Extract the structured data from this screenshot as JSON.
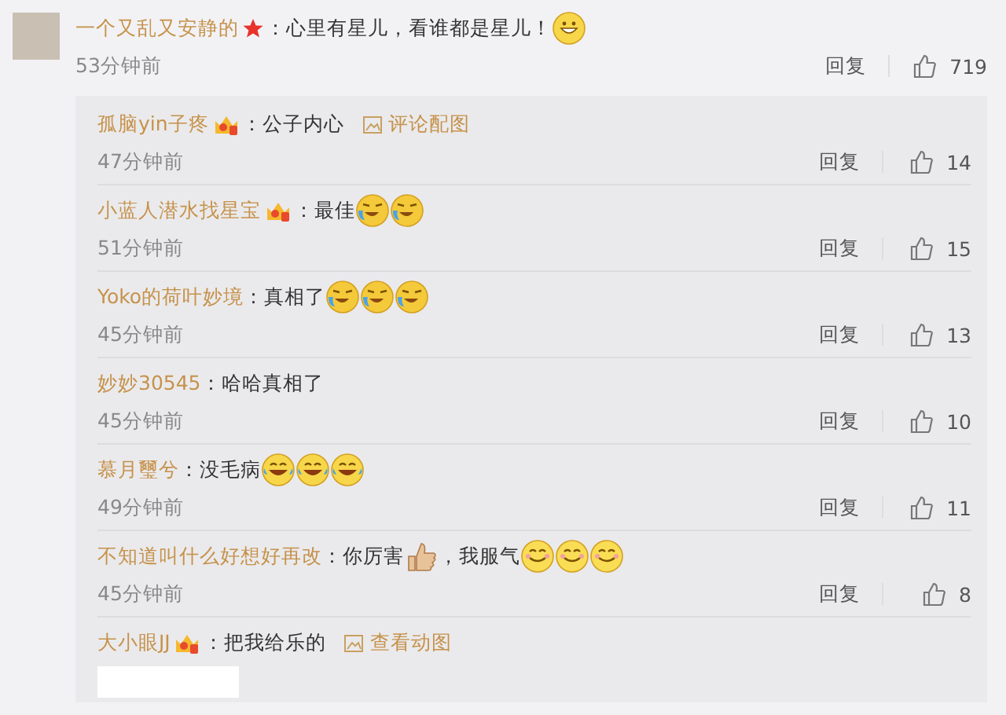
{
  "comment": {
    "author": "一个又乱又安静的",
    "badge": {
      "kind": "star"
    },
    "content": [
      {
        "kind": "text",
        "text": "：心里有星儿，看谁都是星儿！"
      },
      {
        "kind": "grin"
      }
    ],
    "time": "53分钟前",
    "reply_label": "回复",
    "likes": "719"
  },
  "replies": [
    {
      "author": "孤脑yin子疼",
      "badge": {
        "kind": "crown"
      },
      "content": [
        {
          "kind": "text",
          "text": "：公子内心"
        },
        {
          "kind": "link",
          "text": "评论配图"
        }
      ],
      "time": "47分钟前",
      "reply_label": "回复",
      "likes": "14"
    },
    {
      "author": "小蓝人潜水找星宝",
      "badge": {
        "kind": "crown"
      },
      "content": [
        {
          "kind": "text",
          "text": "：最佳"
        },
        {
          "kind": "tears"
        },
        {
          "kind": "tears"
        }
      ],
      "time": "51分钟前",
      "reply_label": "回复",
      "likes": "15"
    },
    {
      "author": "Yoko的荷叶妙境",
      "content": [
        {
          "kind": "text",
          "text": "：真相了"
        },
        {
          "kind": "tears"
        },
        {
          "kind": "tears"
        },
        {
          "kind": "tears"
        }
      ],
      "time": "45分钟前",
      "reply_label": "回复",
      "likes": "13"
    },
    {
      "author": "妙妙30545",
      "content": [
        {
          "kind": "text",
          "text": "：哈哈真相了"
        }
      ],
      "time": "45分钟前",
      "reply_label": "回复",
      "likes": "10"
    },
    {
      "author": "慕月璽兮",
      "content": [
        {
          "kind": "text",
          "text": "：没毛病"
        },
        {
          "kind": "laugh"
        },
        {
          "kind": "laugh"
        },
        {
          "kind": "laugh"
        }
      ],
      "time": "49分钟前",
      "reply_label": "回复",
      "likes": "11"
    },
    {
      "author": "不知道叫什么好想好再改",
      "content": [
        {
          "kind": "text",
          "text": "：你厉害"
        },
        {
          "kind": "thumb"
        },
        {
          "kind": "text",
          "text": "，我服气"
        },
        {
          "kind": "smile"
        },
        {
          "kind": "smile"
        },
        {
          "kind": "smile"
        }
      ],
      "time": "45分钟前",
      "reply_label": "回复",
      "likes": "8"
    },
    {
      "author": "大小眼JJ",
      "badge": {
        "kind": "crown"
      },
      "content": [
        {
          "kind": "text",
          "text": "：把我给乐的"
        },
        {
          "kind": "link",
          "text": "查看动图"
        }
      ],
      "image": true
    }
  ]
}
